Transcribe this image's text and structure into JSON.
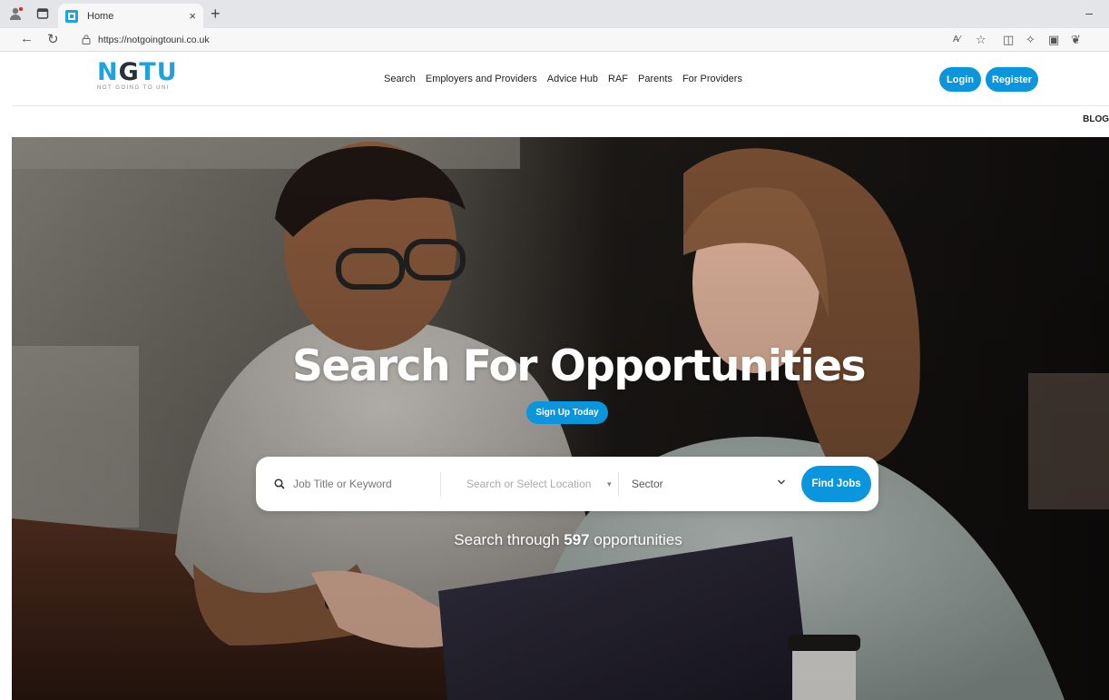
{
  "browser": {
    "tab_title": "Home",
    "tab_close": "×",
    "new_tab": "+",
    "url": "https://notgoingtouni.co.uk",
    "minimize": "–"
  },
  "header": {
    "logo_letters": [
      "N",
      "G",
      "T",
      "U"
    ],
    "logo_tagline": "NOT GOING TO UNI",
    "nav": [
      "Search",
      "Employers and Providers",
      "Advice Hub",
      "RAF",
      "Parents",
      "For Providers"
    ],
    "login_label": "Login",
    "register_label": "Register",
    "blog_label": "BLOG"
  },
  "hero": {
    "title": "Search For Opportunities",
    "signup_label": "Sign Up Today",
    "search": {
      "keyword_placeholder": "Job Title or Keyword",
      "location_placeholder": "Search or Select Location",
      "sector_label": "Sector",
      "find_label": "Find Jobs"
    },
    "count_prefix": "Search through",
    "count_value": "597",
    "count_suffix": "opportunities"
  },
  "colors": {
    "accent": "#0a95dc",
    "logo_blue": "#1ea3de",
    "logo_dark": "#263238"
  }
}
